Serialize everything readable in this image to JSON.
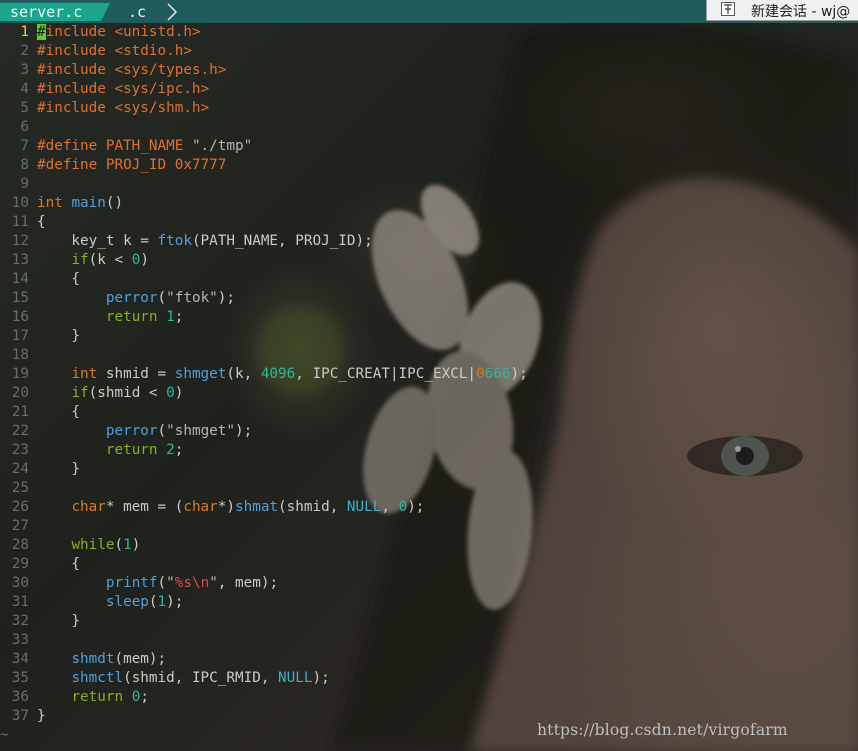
{
  "tabs": [
    {
      "label": "server.c",
      "active": true
    },
    {
      "label": ".c",
      "active": false
    }
  ],
  "session_button": {
    "label": "新建会话 - wj@"
  },
  "editor": {
    "current_line": 1,
    "end_marker": "~",
    "lines": [
      {
        "n": "1",
        "tokens": [
          [
            "cursor",
            "#"
          ],
          [
            "pre",
            "include <unistd.h>"
          ]
        ]
      },
      {
        "n": "2",
        "tokens": [
          [
            "pre",
            "#include <stdio.h>"
          ]
        ]
      },
      {
        "n": "3",
        "tokens": [
          [
            "pre",
            "#include <sys/types.h>"
          ]
        ]
      },
      {
        "n": "4",
        "tokens": [
          [
            "pre",
            "#include <sys/ipc.h>"
          ]
        ]
      },
      {
        "n": "5",
        "tokens": [
          [
            "pre",
            "#include <sys/shm.h>"
          ]
        ]
      },
      {
        "n": "6",
        "tokens": []
      },
      {
        "n": "7",
        "tokens": [
          [
            "pre",
            "#define PATH_NAME "
          ],
          [
            "str",
            "\"./tmp\""
          ]
        ]
      },
      {
        "n": "8",
        "tokens": [
          [
            "pre",
            "#define PROJ_ID 0x7777"
          ]
        ]
      },
      {
        "n": "9",
        "tokens": []
      },
      {
        "n": "10",
        "tokens": [
          [
            "type",
            "int"
          ],
          [
            "plain",
            " "
          ],
          [
            "func",
            "main"
          ],
          [
            "plain",
            "()"
          ]
        ]
      },
      {
        "n": "11",
        "tokens": [
          [
            "plain",
            "{"
          ]
        ]
      },
      {
        "n": "12",
        "tokens": [
          [
            "plain",
            "    key_t k = "
          ],
          [
            "func",
            "ftok"
          ],
          [
            "plain",
            "(PATH_NAME, PROJ_ID);"
          ]
        ]
      },
      {
        "n": "13",
        "tokens": [
          [
            "plain",
            "    "
          ],
          [
            "kw",
            "if"
          ],
          [
            "plain",
            "(k < "
          ],
          [
            "num",
            "0"
          ],
          [
            "plain",
            ")"
          ]
        ]
      },
      {
        "n": "14",
        "tokens": [
          [
            "plain",
            "    {"
          ]
        ]
      },
      {
        "n": "15",
        "tokens": [
          [
            "plain",
            "        "
          ],
          [
            "func",
            "perror"
          ],
          [
            "plain",
            "("
          ],
          [
            "str",
            "\"ftok\""
          ],
          [
            "plain",
            ");"
          ]
        ]
      },
      {
        "n": "16",
        "tokens": [
          [
            "plain",
            "        "
          ],
          [
            "kw",
            "return"
          ],
          [
            "plain",
            " "
          ],
          [
            "num",
            "1"
          ],
          [
            "plain",
            ";"
          ]
        ]
      },
      {
        "n": "17",
        "tokens": [
          [
            "plain",
            "    }"
          ]
        ]
      },
      {
        "n": "18",
        "tokens": []
      },
      {
        "n": "19",
        "tokens": [
          [
            "plain",
            "    "
          ],
          [
            "type",
            "int"
          ],
          [
            "plain",
            " shmid = "
          ],
          [
            "func",
            "shmget"
          ],
          [
            "plain",
            "(k, "
          ],
          [
            "num",
            "4096"
          ],
          [
            "plain",
            ", IPC_CREAT|IPC_EXCL|"
          ],
          [
            "type",
            "0"
          ],
          [
            "num",
            "666"
          ],
          [
            "plain",
            ");"
          ]
        ]
      },
      {
        "n": "20",
        "tokens": [
          [
            "plain",
            "    "
          ],
          [
            "kw",
            "if"
          ],
          [
            "plain",
            "(shmid < "
          ],
          [
            "num",
            "0"
          ],
          [
            "plain",
            ")"
          ]
        ]
      },
      {
        "n": "21",
        "tokens": [
          [
            "plain",
            "    {"
          ]
        ]
      },
      {
        "n": "22",
        "tokens": [
          [
            "plain",
            "        "
          ],
          [
            "func",
            "perror"
          ],
          [
            "plain",
            "("
          ],
          [
            "str",
            "\"shmget\""
          ],
          [
            "plain",
            ");"
          ]
        ]
      },
      {
        "n": "23",
        "tokens": [
          [
            "plain",
            "        "
          ],
          [
            "kw",
            "return"
          ],
          [
            "plain",
            " "
          ],
          [
            "num",
            "2"
          ],
          [
            "plain",
            ";"
          ]
        ]
      },
      {
        "n": "24",
        "tokens": [
          [
            "plain",
            "    }"
          ]
        ]
      },
      {
        "n": "25",
        "tokens": []
      },
      {
        "n": "26",
        "tokens": [
          [
            "plain",
            "    "
          ],
          [
            "type",
            "char"
          ],
          [
            "plain",
            "* mem = ("
          ],
          [
            "type",
            "char"
          ],
          [
            "plain",
            "*)"
          ],
          [
            "func",
            "shmat"
          ],
          [
            "plain",
            "(shmid, "
          ],
          [
            "const",
            "NULL"
          ],
          [
            "plain",
            ", "
          ],
          [
            "num",
            "0"
          ],
          [
            "plain",
            ");"
          ]
        ]
      },
      {
        "n": "27",
        "tokens": []
      },
      {
        "n": "28",
        "tokens": [
          [
            "plain",
            "    "
          ],
          [
            "kw",
            "while"
          ],
          [
            "plain",
            "("
          ],
          [
            "num",
            "1"
          ],
          [
            "plain",
            ")"
          ]
        ]
      },
      {
        "n": "29",
        "tokens": [
          [
            "plain",
            "    {"
          ]
        ]
      },
      {
        "n": "30",
        "tokens": [
          [
            "plain",
            "        "
          ],
          [
            "func",
            "printf"
          ],
          [
            "plain",
            "("
          ],
          [
            "str",
            "\""
          ],
          [
            "fmt",
            "%s\\n"
          ],
          [
            "str",
            "\""
          ],
          [
            "plain",
            ", mem);"
          ]
        ]
      },
      {
        "n": "31",
        "tokens": [
          [
            "plain",
            "        "
          ],
          [
            "func",
            "sleep"
          ],
          [
            "plain",
            "("
          ],
          [
            "num",
            "1"
          ],
          [
            "plain",
            ");"
          ]
        ]
      },
      {
        "n": "32",
        "tokens": [
          [
            "plain",
            "    }"
          ]
        ]
      },
      {
        "n": "33",
        "tokens": []
      },
      {
        "n": "34",
        "tokens": [
          [
            "plain",
            "    "
          ],
          [
            "func",
            "shmdt"
          ],
          [
            "plain",
            "(mem);"
          ]
        ]
      },
      {
        "n": "35",
        "tokens": [
          [
            "plain",
            "    "
          ],
          [
            "func",
            "shmctl"
          ],
          [
            "plain",
            "(shmid, IPC_RMID, "
          ],
          [
            "const",
            "NULL"
          ],
          [
            "plain",
            ");"
          ]
        ]
      },
      {
        "n": "36",
        "tokens": [
          [
            "plain",
            "    "
          ],
          [
            "kw",
            "return"
          ],
          [
            "plain",
            " "
          ],
          [
            "num",
            "0"
          ],
          [
            "plain",
            ";"
          ]
        ]
      },
      {
        "n": "37",
        "tokens": [
          [
            "plain",
            "}"
          ]
        ]
      }
    ]
  },
  "watermark": "https://blog.csdn.net/virgofarm",
  "colors": {
    "tabbar": "#1f5c5c",
    "active_tab": "#1aa58c",
    "line_number": "#6a6e68",
    "current_line_number": "#e8c948",
    "preprocessor": "#e0702e",
    "type": "#d67c24",
    "function": "#4ea0dc",
    "number": "#2fb59e",
    "keyword": "#86b024",
    "cursor": "#5bd22a"
  }
}
